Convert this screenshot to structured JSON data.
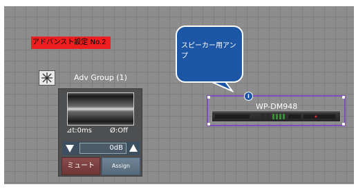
{
  "label": {
    "text": "アドバンスト設定 No.2",
    "color": "#ee1e1e"
  },
  "group": {
    "title": "Adv Group (1)",
    "icon": "star-burst-icon",
    "delay": "⊿t:0ms",
    "phase": "Ø:Off",
    "volume": "0dB",
    "mute_label": "ミュート",
    "assign_label": "Assign"
  },
  "bubble": {
    "text": "スピーカー用アンプ",
    "color": "#1e56a6"
  },
  "amp": {
    "name": "WP-DM948",
    "info_icon": "info-icon",
    "selection_color": "#7c4bbd"
  }
}
